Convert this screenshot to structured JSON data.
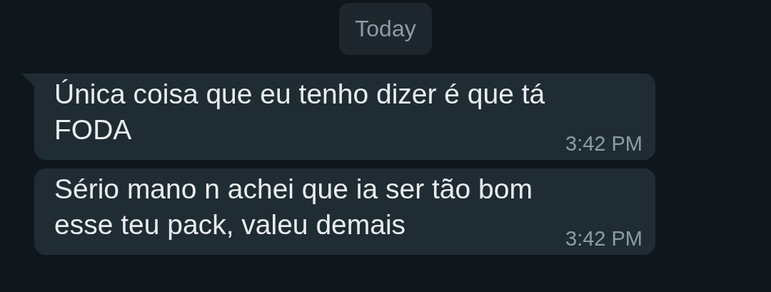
{
  "date_divider": {
    "label": "Today"
  },
  "messages": [
    {
      "text": "Única coisa que eu tenho dizer é que tá FODA",
      "time": "3:42 PM",
      "tail": true
    },
    {
      "text": "Sério mano n achei que ia ser tão bom esse teu pack, valeu demais",
      "time": "3:42 PM",
      "tail": false
    }
  ]
}
